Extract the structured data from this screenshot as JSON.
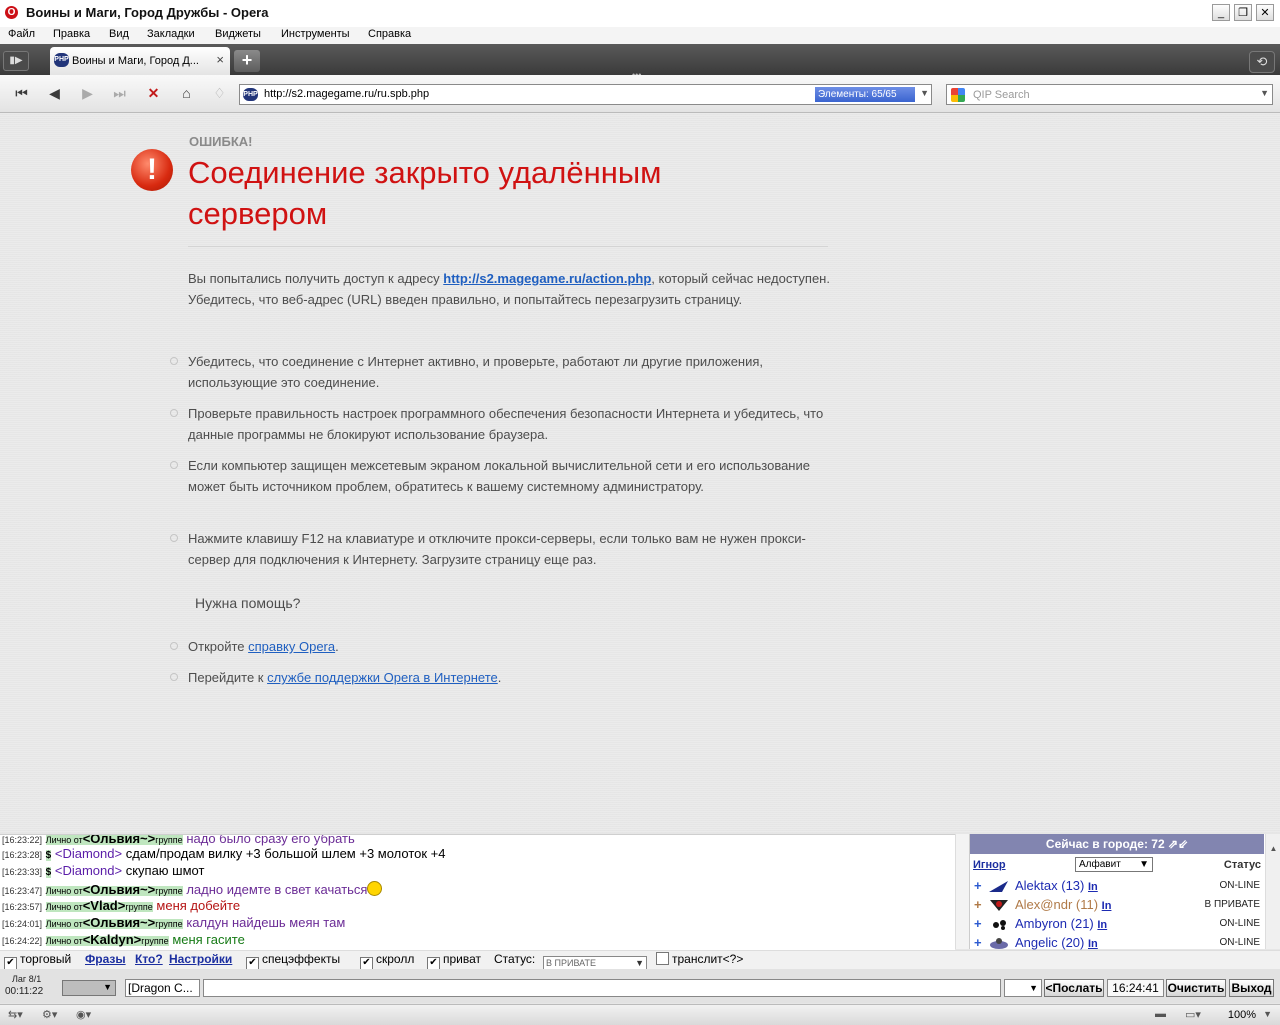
{
  "window": {
    "title": "Воины и Маги, Город Дружбы - Opera",
    "controls": [
      "_",
      "❐",
      "✕"
    ]
  },
  "menu": [
    "Файл",
    "Правка",
    "Вид",
    "Закладки",
    "Виджеты",
    "Инструменты",
    "Справка"
  ],
  "tab": {
    "label": "Воины и Маги, Город Д...",
    "favicon": "PHP"
  },
  "address": {
    "url": "http://s2.magegame.ru/ru.spb.php",
    "elements": "Элементы:   65/65",
    "search_placeholder": "QIP Search"
  },
  "error": {
    "label": "ОШИБКА!",
    "title": "Соединение закрыто удалённым сервером",
    "intro_before": "Вы попытались получить доступ к адресу ",
    "intro_link": "http://s2.magegame.ru/action.php",
    "intro_after": ", который сейчас недоступен. Убедитесь, что веб-адрес (URL) введен правильно, и попытайтесь перезагрузить страницу.",
    "tips": [
      "Убедитесь, что соединение с Интернет активно, и проверьте, работают ли другие приложения, использующие это соединение.",
      "Проверьте правильность настроек программного обеспечения безопасности Интернета и убедитесь, что данные программы не блокируют использование браузера.",
      "Если компьютер защищен межсетевым экраном локальной вычислительной сети и его использование может быть источником проблем, обратитесь к вашему системному администратору.",
      "Нажмите клавишу F12 на клавиатуре и отключите прокси-серверы, если только вам не нужен прокси-сервер для подключения к Интернету. Загрузите страницу еще раз."
    ],
    "help_heading": "Нужна помощь?",
    "help1_before": "Откройте ",
    "help1_link": "справку Opera",
    "help1_after": ".",
    "help2_before": "Перейдите к ",
    "help2_link": "службе поддержки Opera в Интернете",
    "help2_after": "."
  },
  "chat": [
    {
      "time": "[16:23:22]",
      "private": "Лично от",
      "nick": "<Ольвия~>",
      "group": "группе",
      "text": "надо было сразу его убрать",
      "color": "purple"
    },
    {
      "time": "[16:23:28]",
      "dollar": "$",
      "nick": "<Diamond>",
      "text": "сдам/продам вилку +3 большой шлем +3 молоток +4",
      "color": "black"
    },
    {
      "time": "[16:23:33]",
      "dollar": "$",
      "nick": "<Diamond>",
      "text": "скупаю шмот",
      "color": "black"
    },
    {
      "time": "[16:23:47]",
      "private": "Лично от",
      "nick": "<Ольвия~>",
      "group": "группе",
      "text": "ладно идемте в свет качаться",
      "color": "purple",
      "smile": true
    },
    {
      "time": "[16:23:57]",
      "private": "Лично от",
      "nick": "<Vlad>",
      "group": "группе",
      "text": "меня добейте",
      "color": "red"
    },
    {
      "time": "[16:24:01]",
      "private": "Лично от",
      "nick": "<Ольвия~>",
      "group": "группе",
      "text": "калдун найдешь меян там",
      "color": "purple"
    },
    {
      "time": "[16:24:22]",
      "private": "Лично от",
      "nick": "<Kaldyn>",
      "group": "группе",
      "text": "меня гасите",
      "color": "green"
    }
  ],
  "city": {
    "header": "Сейчас в городе: 72",
    "ignore": "Игнор",
    "sort": "Алфавит",
    "status_col": "Статус",
    "players": [
      {
        "name": "Alektax (13)",
        "link": "In",
        "status": "ON-LINE",
        "color": "#1d2bb2"
      },
      {
        "name": "Alex@ndr (11)",
        "link": "In",
        "status": "В ПРИВАТЕ",
        "color": "#b07a48"
      },
      {
        "name": "Ambyron (21)",
        "link": "In",
        "status": "ON-LINE",
        "color": "#1d2bb2"
      },
      {
        "name": "Angelic (20)",
        "link": "In",
        "status": "ON-LINE",
        "color": "#1d2bb2"
      }
    ]
  },
  "controls": {
    "trade": "торговый",
    "phrases": "Фразы",
    "who": "Кто?",
    "settings": "Настройки",
    "effects": "спецэффекты",
    "scroll": "скролл",
    "private": "приват",
    "status_label": "Статус:",
    "status_value": "В ПРИВАТЕ",
    "translit": "транслит",
    "translit_help": "<?>"
  },
  "input": {
    "lag": "Лаг 8/1",
    "lag_time": "00:11:22",
    "recipient": "[Dragon C...",
    "send": "<Послать",
    "time": "16:24:41",
    "clear": "Очистить",
    "exit": "Выход"
  },
  "statusbar": {
    "zoom": "100%"
  }
}
